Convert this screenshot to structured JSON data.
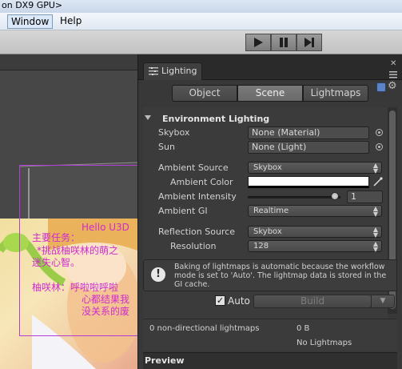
{
  "window": {
    "title": "on DX9 GPU>"
  },
  "menu": {
    "items": [
      "Window",
      "Help"
    ]
  },
  "toolbar": {
    "play_icon": "play-icon",
    "pause_icon": "pause-icon",
    "step_icon": "step-icon"
  },
  "scene": {
    "texts": [
      "Hello U3D",
      "主要任务：",
      "*挑战柚咲林的萌之",
      "迷失心智。",
      "柚咲林：呼啦啦呼啦",
      "心都结果我",
      "没关系的废"
    ],
    "accent": "#d02ad0"
  },
  "lighting": {
    "tab_title": "Lighting",
    "mode_tabs": [
      "Object",
      "Scene",
      "Lightmaps"
    ],
    "active_tab": "Scene",
    "section_title": "Environment Lighting",
    "fields": {
      "skybox": {
        "label": "Skybox",
        "value": "None (Material)"
      },
      "sun": {
        "label": "Sun",
        "value": "None (Light)"
      },
      "ambient_source": {
        "label": "Ambient Source",
        "value": "Skybox"
      },
      "ambient_color": {
        "label": "Ambient Color",
        "value": "#ffffff"
      },
      "ambient_intensity": {
        "label": "Ambient Intensity",
        "value": "1",
        "fraction": 0.94
      },
      "ambient_gi": {
        "label": "Ambient GI",
        "value": "Realtime"
      },
      "reflection_source": {
        "label": "Reflection Source",
        "value": "Skybox"
      },
      "resolution": {
        "label": "Resolution",
        "value": "128"
      }
    },
    "info_text": "Baking of lightmaps is automatic because the workflow mode is set to 'Auto'. The lightmap data is stored in the GI cache.",
    "auto_label": "Auto",
    "auto_checked": true,
    "build_label": "Build",
    "stats": {
      "lightmaps": "0 non-directional lightmaps",
      "size": "0 B",
      "status": "No Lightmaps"
    },
    "preview_label": "Preview"
  }
}
